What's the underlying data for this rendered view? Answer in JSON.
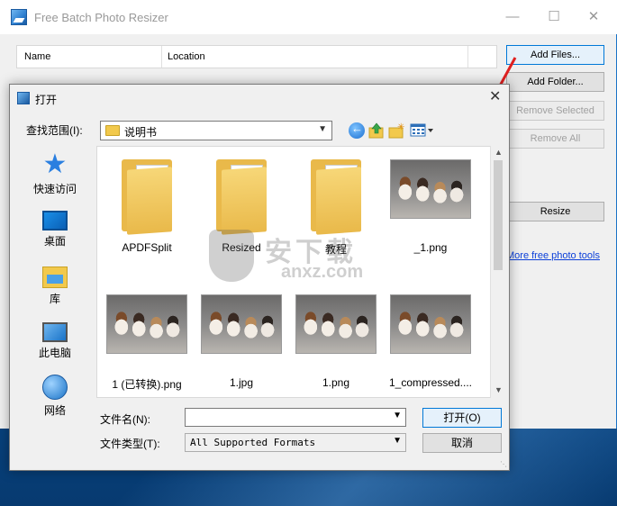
{
  "app": {
    "title": "Free Batch Photo Resizer",
    "columns": [
      "Name",
      "Location"
    ],
    "buttons": {
      "add_files": "Add Files...",
      "add_folder": "Add Folder...",
      "remove_selected": "Remove Selected",
      "remove_all": "Remove All",
      "resize": "Resize"
    },
    "link": "More free photo tools"
  },
  "dialog": {
    "title": "打开",
    "look_in_label": "查找范围(I):",
    "look_in_value": "说明书",
    "places": [
      "快速访问",
      "桌面",
      "库",
      "此电脑",
      "网络"
    ],
    "files": [
      {
        "name": "APDFSplit",
        "kind": "folder"
      },
      {
        "name": "Resized",
        "kind": "folder"
      },
      {
        "name": "教程",
        "kind": "folder"
      },
      {
        "name": "_1.png",
        "kind": "image"
      },
      {
        "name": "1 (已转换).png",
        "kind": "image"
      },
      {
        "name": "1.jpg",
        "kind": "image"
      },
      {
        "name": "1.png",
        "kind": "image"
      },
      {
        "name": "1_compressed....",
        "kind": "image"
      }
    ],
    "file_name_label": "文件名(N):",
    "file_name_value": "",
    "file_type_label": "文件类型(T):",
    "file_type_value": "All Supported Formats",
    "open_button": "打开(O)",
    "cancel_button": "取消"
  },
  "watermark": {
    "cn": "安下载",
    "en": "anxz.com"
  },
  "colors": {
    "accent": "#0078d7",
    "link": "#0b3fd9",
    "arrow": "#e02020"
  }
}
